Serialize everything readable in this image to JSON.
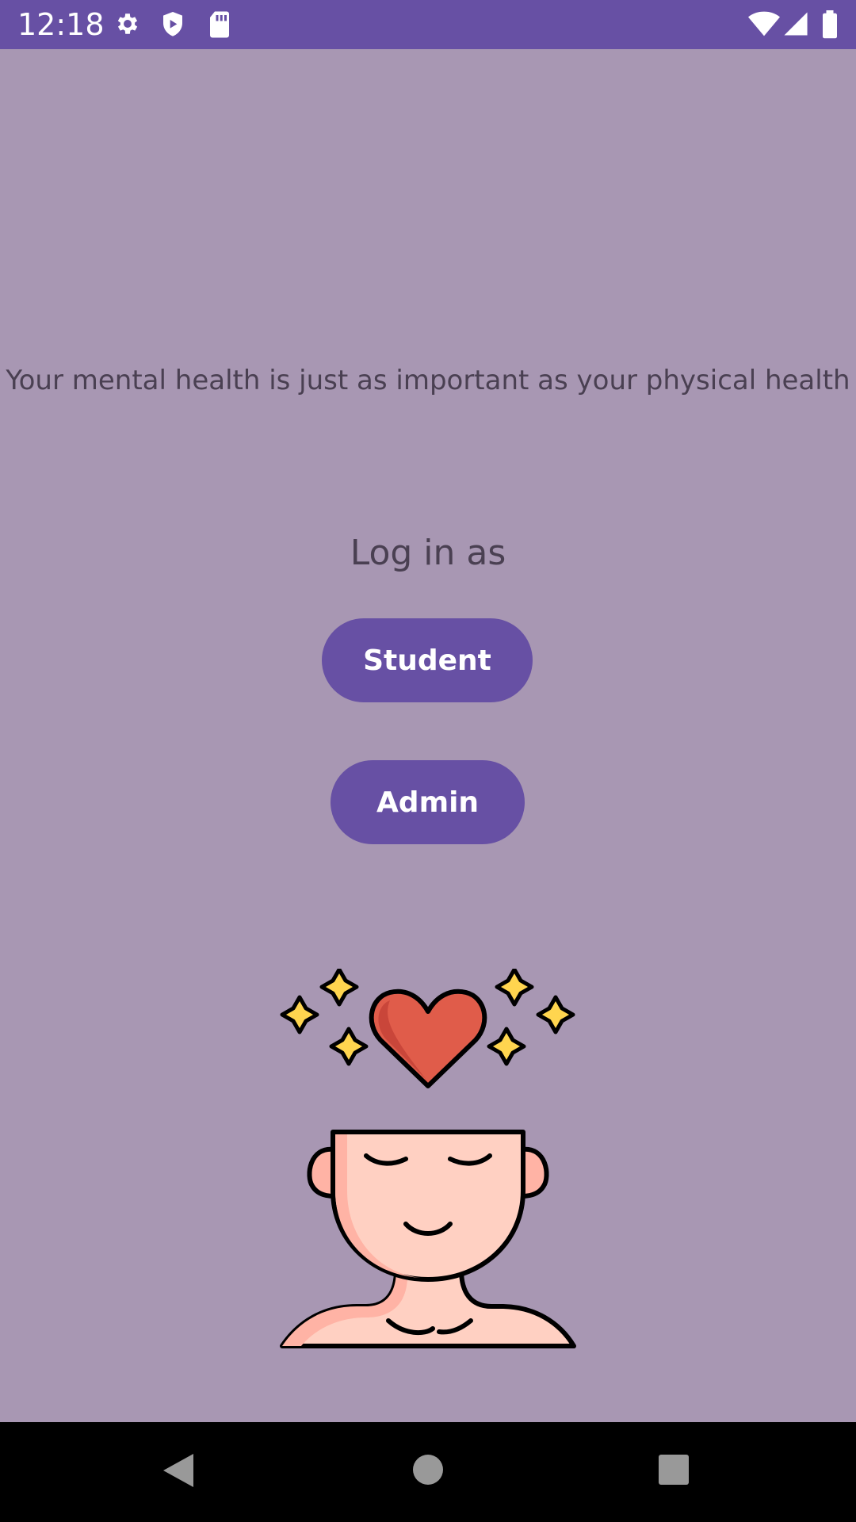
{
  "status_bar": {
    "time": "12:18",
    "icons_left": [
      "gear-icon",
      "shield-play-icon",
      "sd-card-icon"
    ],
    "icons_right": [
      "wifi-icon",
      "signal-icon",
      "battery-icon"
    ]
  },
  "main": {
    "quote": "Your mental health is just as important as your physical health",
    "login_label": "Log in as",
    "student_button": "Student",
    "admin_button": "Admin",
    "illustration": "mind-heart-illustration-icon"
  },
  "nav_bar": {
    "buttons": [
      "back-icon",
      "home-icon",
      "recents-icon"
    ]
  },
  "colors": {
    "primary": "#6750a4",
    "background": "#a897b3",
    "text": "#4a4052",
    "heart": "#e05c4a",
    "skin": "#ffd0c2",
    "sparkle": "#ffd54f"
  }
}
